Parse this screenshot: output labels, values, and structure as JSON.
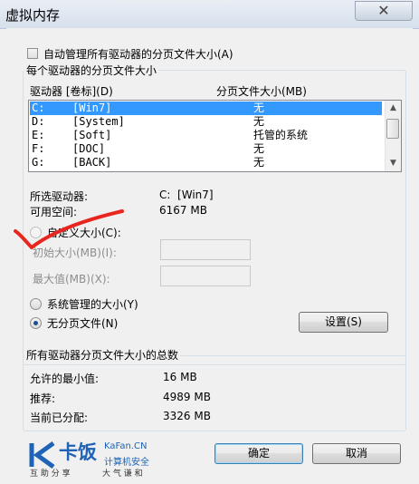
{
  "window": {
    "title": "虚拟内存"
  },
  "auto_manage": {
    "label": "自动管理所有驱动器的分页文件大小(A)",
    "checked": false
  },
  "per_drive": {
    "group_title": "每个驱动器的分页文件大小",
    "columns": {
      "drive": "驱动器 [卷标](D)",
      "size": "分页文件大小(MB)"
    },
    "rows": [
      {
        "letter": "C:",
        "label": "[Win7]",
        "size": "无",
        "selected": true
      },
      {
        "letter": "D:",
        "label": "[System]",
        "size": "无",
        "selected": false
      },
      {
        "letter": "E:",
        "label": "[Soft]",
        "size": "托管的系统",
        "selected": false
      },
      {
        "letter": "F:",
        "label": "[DOC]",
        "size": "无",
        "selected": false
      },
      {
        "letter": "G:",
        "label": "[BACK]",
        "size": "无",
        "selected": false
      }
    ],
    "selected_drive_label": "所选驱动器:",
    "selected_drive_value": "C:  [Win7]",
    "free_space_label": "可用空间:",
    "free_space_value": "6167 MB",
    "custom_size_label": "自定义大小(C):",
    "initial_size_label": "初始大小(MB)(I):",
    "initial_size_value": "",
    "max_size_label": "最大值(MB)(X):",
    "max_size_value": "",
    "system_managed_label": "系统管理的大小(Y)",
    "no_paging_label": "无分页文件(N)",
    "selected_option": "no_paging",
    "set_button": "设置(S)"
  },
  "totals": {
    "group_title": "所有驱动器分页文件大小的总数",
    "min_allowed_label": "允许的最小值:",
    "min_allowed_value": "16 MB",
    "recommended_label": "推荐:",
    "recommended_value": "4989 MB",
    "allocated_label": "当前已分配:",
    "allocated_value": "3326 MB"
  },
  "watermark": {
    "brand": "卡饭",
    "domain": "KaFan.CN",
    "tagline": "计算机安全",
    "slogan_left": "互 助 分 享",
    "slogan_right": "大 气 谦 和"
  },
  "buttons": {
    "ok": "确定",
    "cancel": "取消"
  },
  "colors": {
    "selection": "#3399ff",
    "annotation": "#e8261f",
    "brand_blue": "#1e63b5"
  }
}
